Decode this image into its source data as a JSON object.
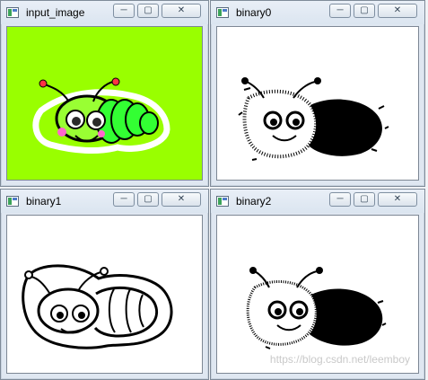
{
  "windows": [
    {
      "title": "input_image",
      "buttons": {
        "minimize": "─",
        "maximize": "▢",
        "close": "✕"
      }
    },
    {
      "title": "binary0",
      "buttons": {
        "minimize": "─",
        "maximize": "▢",
        "close": "✕"
      }
    },
    {
      "title": "binary1",
      "buttons": {
        "minimize": "─",
        "maximize": "▢",
        "close": "✕"
      }
    },
    {
      "title": "binary2",
      "buttons": {
        "minimize": "─",
        "maximize": "▢",
        "close": "✕"
      }
    }
  ],
  "watermark": "https://blog.csdn.net/leemboy",
  "colors": {
    "input_background": "#99ff00",
    "caterpillar_head": "#99ff33",
    "caterpillar_body": "#33ff33"
  }
}
